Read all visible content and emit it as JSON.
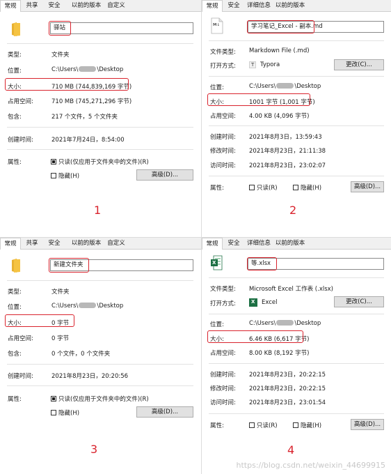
{
  "panels": {
    "p1": {
      "tabs": [
        "常规",
        "共享",
        "安全",
        "以前的版本",
        "自定义"
      ],
      "name": "驿站",
      "rows": {
        "type_label": "类型:",
        "type_value": "文件夹",
        "loc_label": "位置:",
        "loc_prefix": "C:\\Users\\",
        "loc_suffix": "\\Desktop",
        "size_label": "大小:",
        "size_value": "710 MB (744,839,169 字节)",
        "disk_label": "占用空间:",
        "disk_value": "710 MB (745,271,296 字节)",
        "contains_label": "包含:",
        "contains_value": "217 个文件，5 个文件夹",
        "created_label": "创建时间:",
        "created_value": "2021年7月24日，8:54:00",
        "attr_label": "属性:",
        "readonly_label": "只读(仅应用于文件夹中的文件)(R)",
        "hidden_label": "隐藏(H)",
        "advanced_button": "高级(D)..."
      },
      "number": "1"
    },
    "p2": {
      "tabs": [
        "常规",
        "安全",
        "详细信息",
        "以前的版本"
      ],
      "name": "学习笔记_Excel - 副本.md",
      "icon_text": "M↓",
      "rows": {
        "type_label": "文件类型:",
        "type_value": "Markdown File (.md)",
        "open_label": "打开方式:",
        "open_value": "Typora",
        "open_icon_text": "T",
        "change_button": "更改(C)...",
        "loc_label": "位置:",
        "loc_prefix": "C:\\Users\\",
        "loc_suffix": "\\Desktop",
        "size_label": "大小:",
        "size_value": "1001 字节 (1,001 字节)",
        "disk_label": "占用空间:",
        "disk_value": "4.00 KB (4,096 字节)",
        "created_label": "创建时间:",
        "created_value": "2021年8月3日，13:59:43",
        "modified_label": "修改时间:",
        "modified_value": "2021年8月23日，21:11:38",
        "accessed_label": "访问时间:",
        "accessed_value": "2021年8月23日，23:02:07",
        "attr_label": "属性:",
        "readonly_label": "只读(R)",
        "hidden_label": "隐藏(H)",
        "advanced_button": "高级(D)..."
      },
      "number": "2"
    },
    "p3": {
      "tabs": [
        "常规",
        "共享",
        "安全",
        "以前的版本",
        "自定义"
      ],
      "name": "新建文件夹",
      "rows": {
        "type_label": "类型:",
        "type_value": "文件夹",
        "loc_label": "位置:",
        "loc_prefix": "C:\\Users\\",
        "loc_suffix": "\\Desktop",
        "size_label": "大小:",
        "size_value": "0 字节",
        "disk_label": "占用空间:",
        "disk_value": "0 字节",
        "contains_label": "包含:",
        "contains_value": "0 个文件，0 个文件夹",
        "created_label": "创建时间:",
        "created_value": "2021年8月23日，20:20:56",
        "attr_label": "属性:",
        "readonly_label": "只读(仅应用于文件夹中的文件)(R)",
        "hidden_label": "隐藏(H)",
        "advanced_button": "高级(D)..."
      },
      "number": "3"
    },
    "p4": {
      "tabs": [
        "常规",
        "安全",
        "详细信息",
        "以前的版本"
      ],
      "name": "等.xlsx",
      "icon_text": "X",
      "rows": {
        "type_label": "文件类型:",
        "type_value": "Microsoft Excel 工作表 (.xlsx)",
        "open_label": "打开方式:",
        "open_value": "Excel",
        "open_icon_text": "X",
        "change_button": "更改(C)...",
        "loc_label": "位置:",
        "loc_prefix": "C:\\Users\\",
        "loc_suffix": "\\Desktop",
        "size_label": "大小:",
        "size_value": "6.46 KB (6,617 字节)",
        "disk_label": "占用空间:",
        "disk_value": "8.00 KB (8,192 字节)",
        "created_label": "创建时间:",
        "created_value": "2021年8月23日，20:22:15",
        "modified_label": "修改时间:",
        "modified_value": "2021年8月23日，20:22:15",
        "accessed_label": "访问时间:",
        "accessed_value": "2021年8月23日，23:01:54",
        "attr_label": "属性:",
        "readonly_label": "只读(R)",
        "hidden_label": "隐藏(H)",
        "advanced_button": "高级(D)..."
      },
      "number": "4"
    }
  },
  "watermark": "https://blog.csdn.net/weixin_44699915",
  "colors": {
    "highlight": "#d9232d",
    "folder": "#f5c342",
    "excel": "#1d7044"
  }
}
